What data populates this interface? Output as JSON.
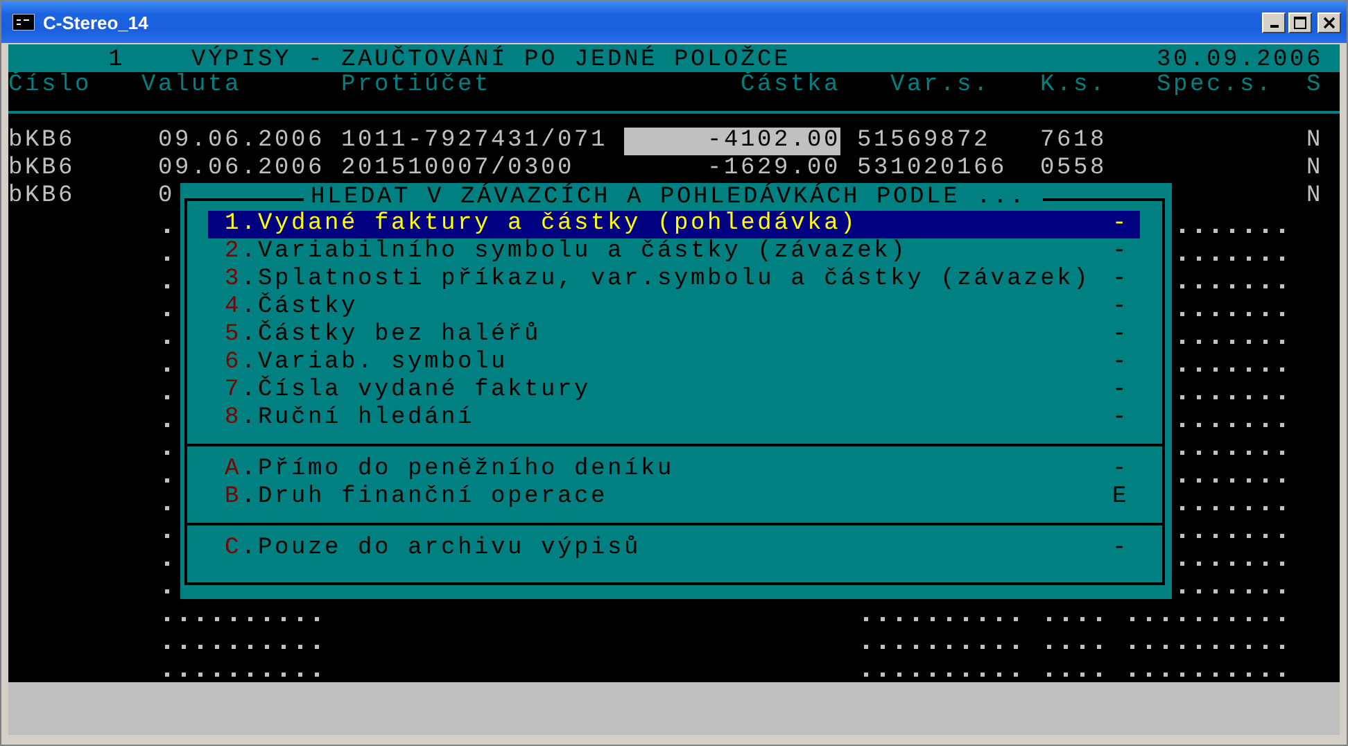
{
  "window": {
    "title": "C-Stereo_14"
  },
  "header": {
    "number": "1",
    "title": "VÝPISY - ZAUČTOVÁNÍ PO JEDNÉ POLOŽCE",
    "date": "30.09.2006"
  },
  "columns": [
    "Číslo",
    "Valuta",
    "Protiúčet",
    "Částka",
    "Var.s.",
    "K.s.",
    "Spec.s.",
    "S"
  ],
  "rows": [
    {
      "number": "bKB6",
      "valuta": "09.06.2006",
      "account": "1011-7927431/071",
      "amount": "-4102.00",
      "var_s": "51569872",
      "k_s": "7618",
      "s": "N",
      "selected": true
    },
    {
      "number": "bKB6",
      "valuta": "09.06.2006",
      "account": "201510007/0300",
      "amount": "-1629.00",
      "var_s": "531020166",
      "k_s": "0558",
      "s": "N",
      "selected": false
    },
    {
      "number": "bKB6",
      "valuta": "0",
      "s": "N"
    }
  ],
  "empty_rows": [
    {
      "kind": "dotted"
    },
    {
      "kind": "dotted"
    },
    {
      "kind": "dotted"
    },
    {
      "kind": "dotted"
    },
    {
      "kind": "dotted"
    },
    {
      "kind": "dotted"
    },
    {
      "kind": "dotted"
    },
    {
      "kind": "dotted"
    },
    {
      "kind": "dotted"
    },
    {
      "kind": "dotted"
    },
    {
      "kind": "dotted"
    },
    {
      "kind": "dotted"
    },
    {
      "kind": "dotted"
    },
    {
      "kind": "dotted"
    },
    {
      "kind": "dotted"
    },
    {
      "kind": "dotted"
    },
    {
      "kind": "dotted"
    }
  ],
  "dialog": {
    "title": "HLEDAT V ZÁVAZCÍCH A POHLEDÁVKÁCH PODLE ...",
    "sections": [
      {
        "items": [
          {
            "key": "1",
            "label": ".Vydané faktury a částky (pohledávka)",
            "mark": "-",
            "selected": true
          },
          {
            "key": "2",
            "label": ".Variabilního symbolu a částky (závazek)",
            "mark": "-",
            "selected": false
          },
          {
            "key": "3",
            "label": ".Splatnosti příkazu, var.symbolu a částky (závazek)",
            "mark": "-",
            "selected": false
          },
          {
            "key": "4",
            "label": ".Částky",
            "mark": "-",
            "selected": false
          },
          {
            "key": "5",
            "label": ".Částky bez haléřů",
            "mark": "-",
            "selected": false
          },
          {
            "key": "6",
            "label": ".Variab. symbolu",
            "mark": "-",
            "selected": false
          },
          {
            "key": "7",
            "label": ".Čísla vydané faktury",
            "mark": "-",
            "selected": false
          },
          {
            "key": "8",
            "label": ".Ruční hledání",
            "mark": "-",
            "selected": false
          }
        ]
      },
      {
        "items": [
          {
            "key": "A",
            "label": ".Přímo do peněžního deníku",
            "mark": "-",
            "selected": false
          },
          {
            "key": "B",
            "label": ".Druh finanční operace",
            "mark": "E",
            "selected": false
          }
        ]
      },
      {
        "items": [
          {
            "key": "C",
            "label": ".Pouze do archivu výpisů",
            "mark": "-",
            "selected": false
          }
        ]
      }
    ]
  }
}
